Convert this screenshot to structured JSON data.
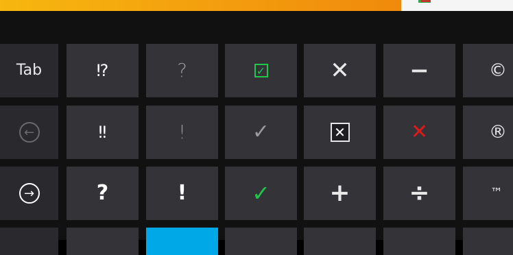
{
  "keyboard": {
    "row1": [
      "Tab",
      "⁉",
      "?",
      "☑",
      "✕",
      "−",
      "©"
    ],
    "row2": [
      "←",
      "‼",
      "!",
      "✓",
      "☒",
      "✕",
      "®"
    ],
    "row3": [
      "→",
      "?",
      "!",
      "✓",
      "+",
      "÷",
      "™"
    ]
  },
  "colors": {
    "key_bg": "#343338",
    "accent": "#00a8e8",
    "green": "#1ec84a",
    "red": "#e01a1a"
  }
}
